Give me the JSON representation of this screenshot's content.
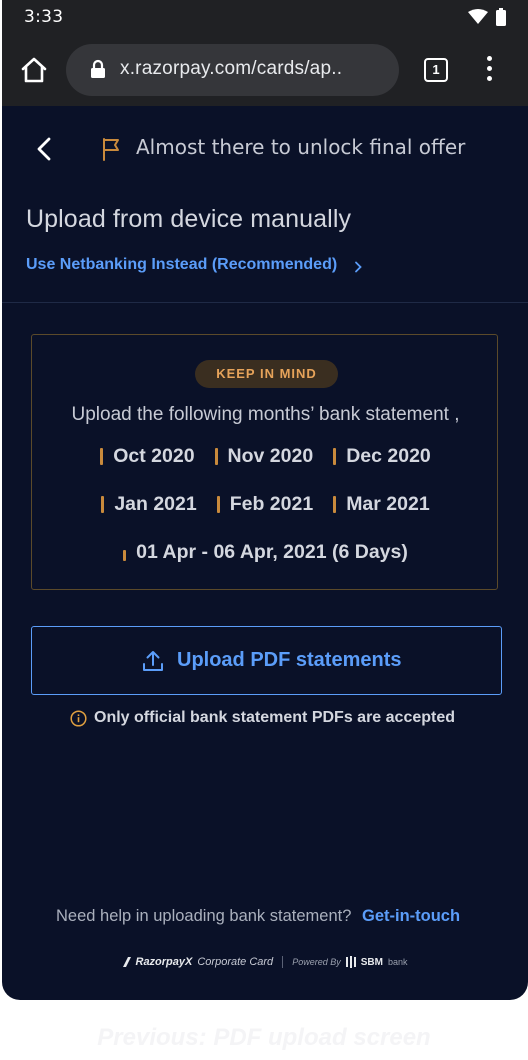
{
  "status_bar": {
    "time": "3:33"
  },
  "browser": {
    "url": "x.razorpay.com/cards/ap..",
    "tab_count": "1"
  },
  "header": {
    "offer_text": "Almost there to unlock final offer"
  },
  "page": {
    "title": "Upload from device manually",
    "netbanking_link": "Use Netbanking Instead (Recommended)"
  },
  "keep_in_mind": {
    "badge": "KEEP IN MIND",
    "text": "Upload the following months’ bank statement ,",
    "months_row1": [
      "Oct 2020",
      "Nov 2020",
      "Dec 2020"
    ],
    "months_row2": [
      "Jan 2021",
      "Feb 2021",
      "Mar 2021"
    ],
    "partial_period": "01 Apr - 06 Apr, 2021 (6 Days)"
  },
  "upload": {
    "button_label": "Upload PDF statements",
    "note": "Only official bank statement PDFs are accepted"
  },
  "footer": {
    "help_text": "Need help in uploading bank statement?",
    "help_link": "Get-in-touch",
    "brand_logo": "RazorpayX",
    "brand_product": "Corporate Card",
    "powered_by": "Powered By",
    "partner": "SBM",
    "partner_suffix": "bank"
  },
  "caption": "Previous: PDF upload screen",
  "colors": {
    "background": "#0a1128",
    "accent_blue": "#5b9df9",
    "accent_gold": "#c98a3c"
  }
}
